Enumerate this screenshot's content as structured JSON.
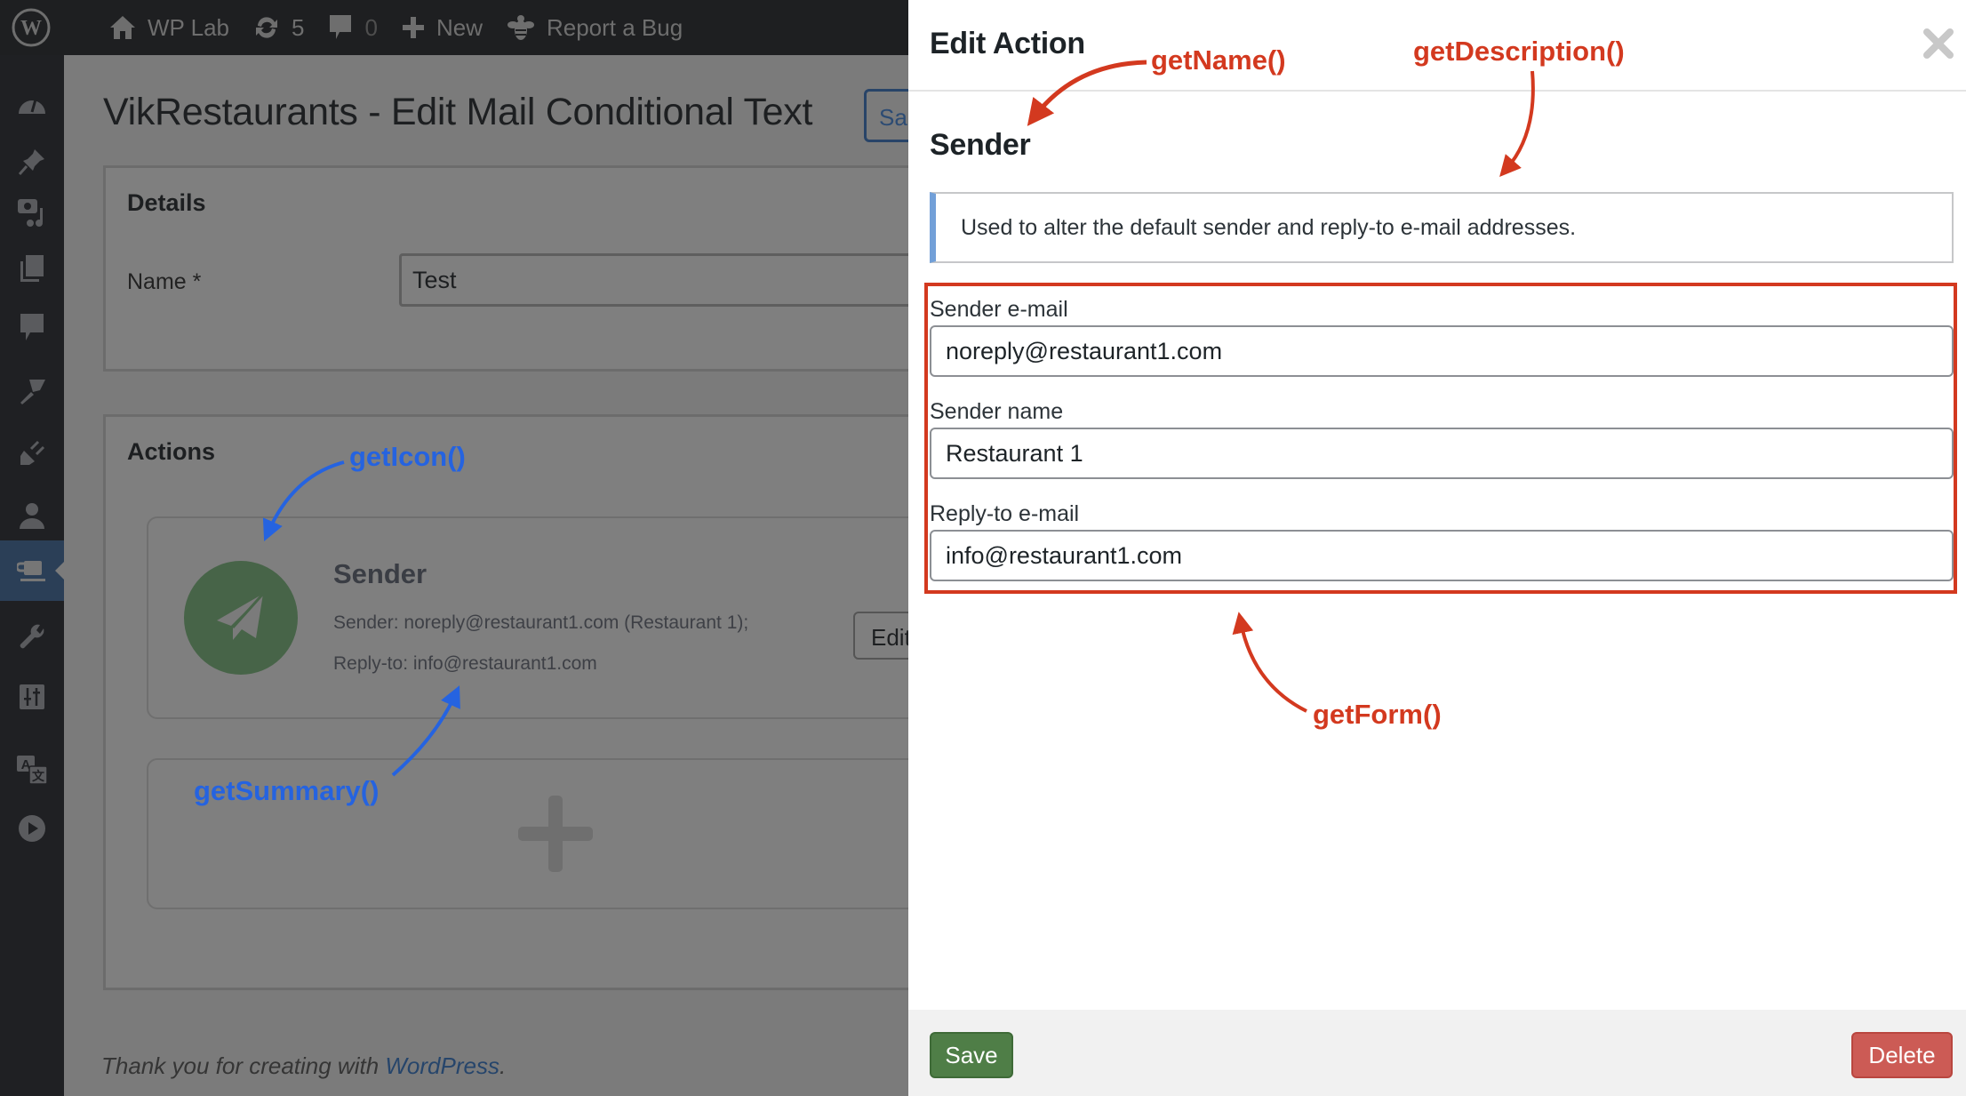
{
  "adminbar": {
    "site_name": "WP Lab",
    "updates_count": "5",
    "comments_count": "0",
    "new_label": "New",
    "report_bug_label": "Report a Bug"
  },
  "sidebar": {
    "items": [
      {
        "icon": "dashboard-icon"
      },
      {
        "icon": "pin-icon"
      },
      {
        "icon": "media-icon"
      },
      {
        "icon": "pages-icon"
      },
      {
        "icon": "comments-icon"
      },
      {
        "icon": "appearance-brush-icon"
      },
      {
        "icon": "plugins-icon"
      },
      {
        "icon": "users-icon"
      },
      {
        "icon": "coffee-cup-icon",
        "active": true
      },
      {
        "icon": "tools-wrench-icon"
      },
      {
        "icon": "settings-sliders-icon"
      },
      {
        "icon": "translate-icon"
      },
      {
        "icon": "play-icon"
      }
    ]
  },
  "page": {
    "title": "VikRestaurants - Edit Mail Conditional Text",
    "save_button": "Sa",
    "details": {
      "title": "Details",
      "name_label": "Name *",
      "name_value": "Test"
    },
    "actions": {
      "title": "Actions",
      "items": [
        {
          "name": "Sender",
          "summary_line1": "Sender: noreply@restaurant1.com (Restaurant 1);",
          "summary_line2": "Reply-to: info@restaurant1.com",
          "edit_label": "Edit",
          "icon": "paper-plane-icon",
          "icon_color": "#476448"
        }
      ]
    },
    "footer": {
      "prefix": "Thank you for creating with ",
      "link": "WordPress",
      "suffix": "."
    }
  },
  "panel": {
    "title": "Edit Action",
    "action_name": "Sender",
    "description": "Used to alter the default sender and reply-to e-mail addresses.",
    "fields": [
      {
        "label": "Sender e-mail",
        "value": "noreply@restaurant1.com"
      },
      {
        "label": "Sender name",
        "value": "Restaurant 1"
      },
      {
        "label": "Reply-to e-mail",
        "value": "info@restaurant1.com"
      }
    ],
    "save_label": "Save",
    "delete_label": "Delete"
  },
  "annotations": {
    "get_icon": "getIcon()",
    "get_summary": "getSummary()",
    "get_name": "getName()",
    "get_description": "getDescription()",
    "get_form": "getForm()",
    "colors": {
      "blue": "#2563e0",
      "red": "#d3391f"
    }
  }
}
